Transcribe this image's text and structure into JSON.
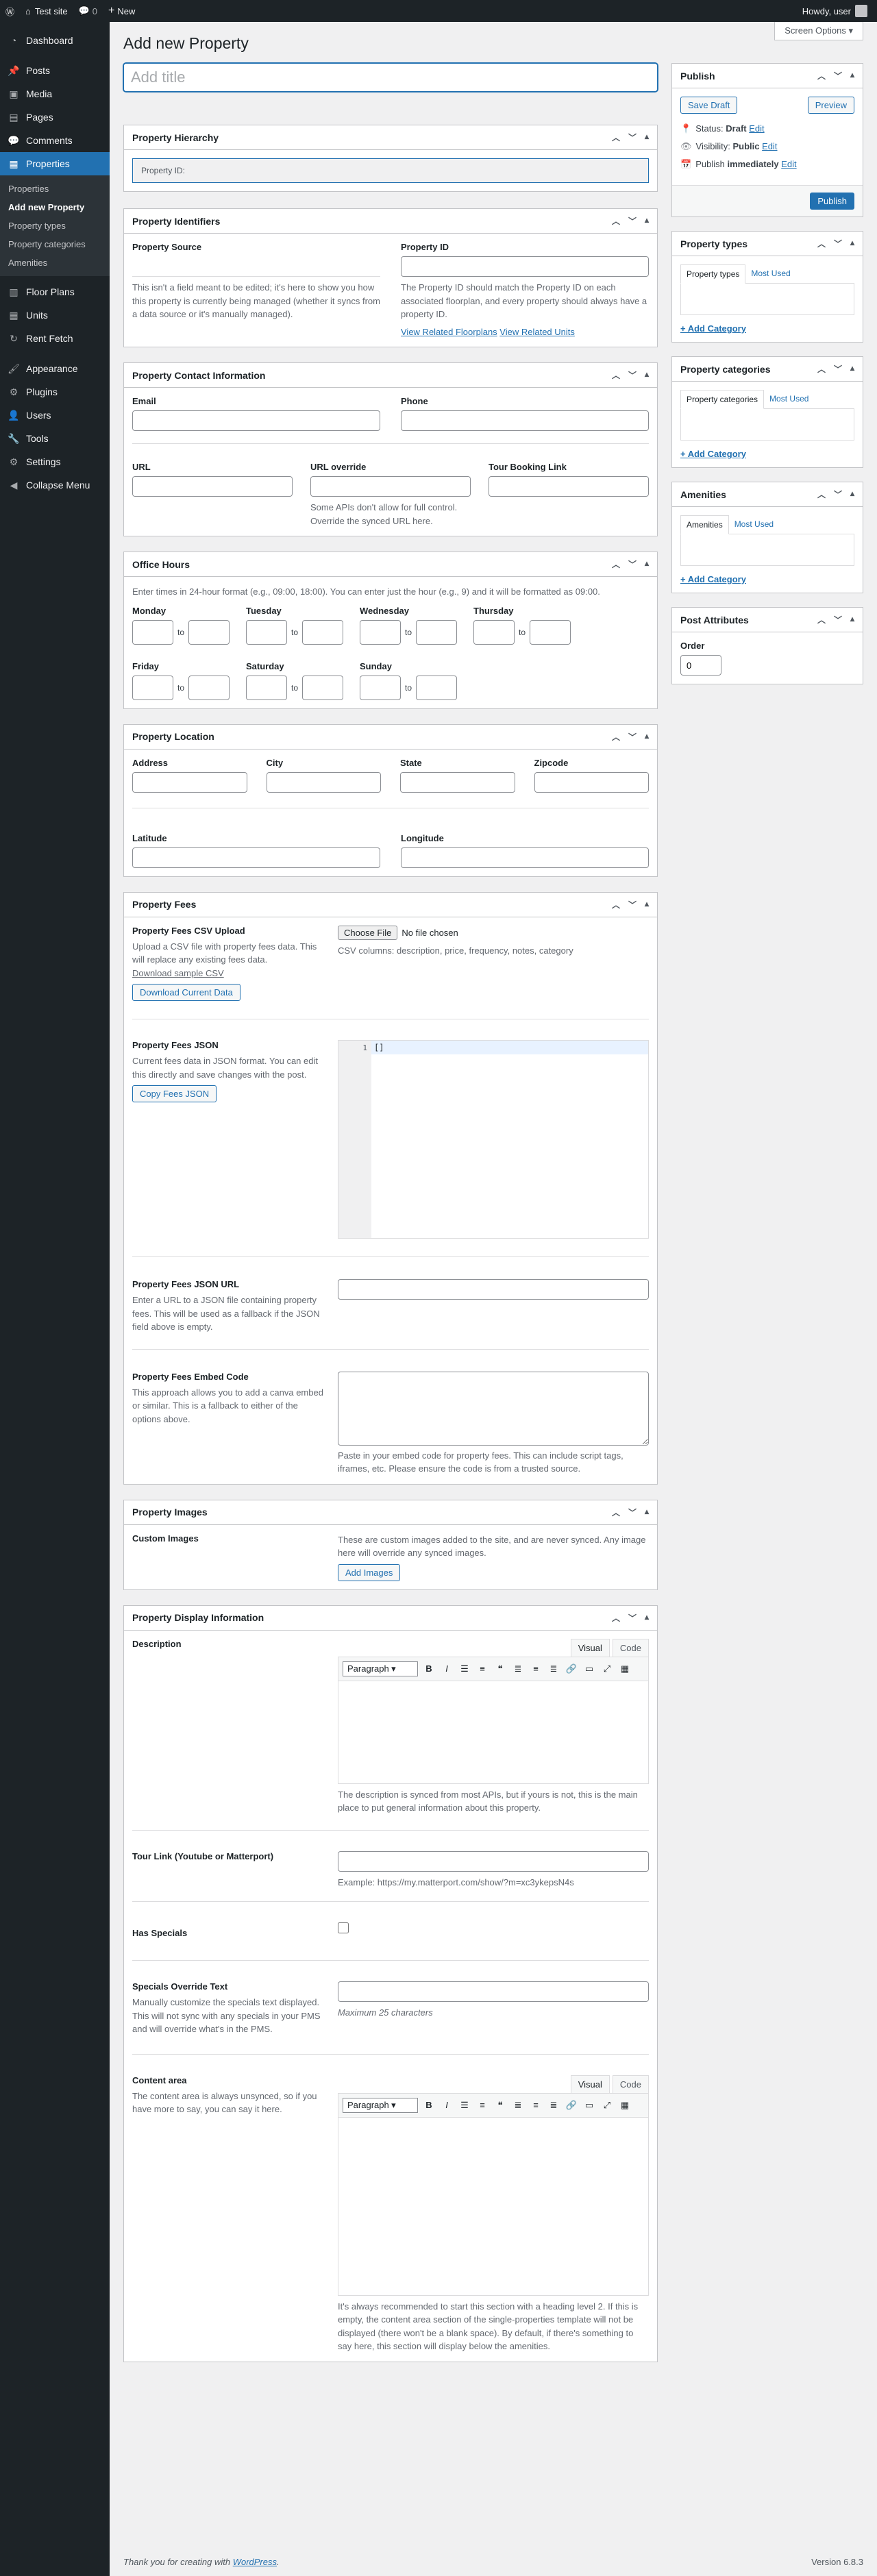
{
  "adminbar": {
    "wp_icon": "wordpress-icon",
    "site_name": "Test site",
    "comments_count": "0",
    "new_label": "New",
    "howdy": "Howdy, user"
  },
  "sidebar": {
    "items": [
      {
        "icon": "dashboard-icon",
        "label": "Dashboard"
      },
      {
        "icon": "pin-icon",
        "label": "Posts"
      },
      {
        "icon": "media-icon",
        "label": "Media"
      },
      {
        "icon": "page-icon",
        "label": "Pages"
      },
      {
        "icon": "comment-icon",
        "label": "Comments"
      },
      {
        "icon": "building-icon",
        "label": "Properties"
      }
    ],
    "submenu": [
      "Properties",
      "Add new Property",
      "Property types",
      "Property categories",
      "Amenities"
    ],
    "items2": [
      {
        "icon": "floorplan-icon",
        "label": "Floor Plans"
      },
      {
        "icon": "units-icon",
        "label": "Units"
      },
      {
        "icon": "refresh-icon",
        "label": "Rent Fetch"
      },
      {
        "icon": "appearance-icon",
        "label": "Appearance"
      },
      {
        "icon": "plugin-icon",
        "label": "Plugins"
      },
      {
        "icon": "users-icon",
        "label": "Users"
      },
      {
        "icon": "tools-icon",
        "label": "Tools"
      },
      {
        "icon": "settings-icon",
        "label": "Settings"
      },
      {
        "icon": "collapse-icon",
        "label": "Collapse Menu"
      }
    ]
  },
  "header": {
    "title": "Add new Property",
    "screen_options": "Screen Options",
    "title_placeholder": "Add title"
  },
  "hierarchy": {
    "title": "Property Hierarchy",
    "label": "Property ID:"
  },
  "identifiers": {
    "title": "Property Identifiers",
    "source_label": "Property Source",
    "source_desc": "This isn't a field meant to be edited; it's here to show you how this property is currently being managed (whether it syncs from a data source or it's manually managed).",
    "id_label": "Property ID",
    "id_desc": "The Property ID should match the Property ID on each associated floorplan, and every property should always have a property ID.",
    "link_floorplans": "View Related Floorplans",
    "link_units": "View Related Units"
  },
  "contact": {
    "title": "Property Contact Information",
    "email": "Email",
    "phone": "Phone",
    "url": "URL",
    "url_override": "URL override",
    "url_override_desc": "Some APIs don't allow for full control. Override the synced URL here.",
    "tour_link": "Tour Booking Link"
  },
  "hours": {
    "title": "Office Hours",
    "instructions": "Enter times in 24-hour format (e.g., 09:00, 18:00). You can enter just the hour (e.g., 9) and it will be formatted as 09:00.",
    "to": "to",
    "days": [
      "Monday",
      "Tuesday",
      "Wednesday",
      "Thursday",
      "Friday",
      "Saturday",
      "Sunday"
    ]
  },
  "location": {
    "title": "Property Location",
    "address": "Address",
    "city": "City",
    "state": "State",
    "zipcode": "Zipcode",
    "latitude": "Latitude",
    "longitude": "Longitude"
  },
  "fees": {
    "title": "Property Fees",
    "csv_label": "Property Fees CSV Upload",
    "csv_desc": "Upload a CSV file with property fees data. This will replace any existing fees data.",
    "csv_sample": "Download sample CSV",
    "csv_download": "Download Current Data",
    "choose_file": "Choose File",
    "no_file": "No file chosen",
    "csv_columns": "CSV columns: description, price, frequency, notes, category",
    "json_label": "Property Fees JSON",
    "json_desc": "Current fees data in JSON format. You can edit this directly and save changes with the post.",
    "json_copy": "Copy Fees JSON",
    "json_line_no": "1",
    "json_value": "[]",
    "json_url_label": "Property Fees JSON URL",
    "json_url_desc": "Enter a URL to a JSON file containing property fees. This will be used as a fallback if the JSON field above is empty.",
    "embed_label": "Property Fees Embed Code",
    "embed_desc": "This approach allows you to add a canva embed or similar. This is a fallback to either of the options above.",
    "embed_help": "Paste in your embed code for property fees. This can include script tags, iframes, etc. Please ensure the code is from a trusted source."
  },
  "images": {
    "title": "Property Images",
    "label": "Custom Images",
    "desc": "These are custom images added to the site, and are never synced. Any image here will override any synced images.",
    "button": "Add Images"
  },
  "display": {
    "title": "Property Display Information",
    "description_label": "Description",
    "visual_tab": "Visual",
    "code_tab": "Code",
    "paragraph": "Paragraph",
    "description_help": "The description is synced from most APIs, but if yours is not, this is the main place to put general information about this property.",
    "tour_label": "Tour Link (Youtube or Matterport)",
    "tour_help": "Example: https://my.matterport.com/show/?m=xc3ykepsN4s",
    "specials_label": "Has Specials",
    "specials_override_label": "Specials Override Text",
    "specials_override_desc": "Manually customize the specials text displayed. This will not sync with any specials in your PMS and will override what's in the PMS.",
    "specials_override_help": "Maximum 25 characters",
    "content_label": "Content area",
    "content_desc": "The content area is always unsynced, so if you have more to say, you can say it here.",
    "content_help": "It's always recommended to start this section with a heading level 2. If this is empty, the content area section of the single-properties template will not be displayed (there won't be a blank space). By default, if there's something to say here, this section will display below the amenities."
  },
  "publish": {
    "title": "Publish",
    "save_draft": "Save Draft",
    "preview": "Preview",
    "status_label": "Status:",
    "status_value": "Draft",
    "visibility_label": "Visibility:",
    "visibility_value": "Public",
    "publish_label": "Publish",
    "publish_value": "immediately",
    "edit": "Edit",
    "publish_button": "Publish"
  },
  "taxonomies": [
    {
      "title": "Property types",
      "tab_all": "Property types",
      "tab_used": "Most Used",
      "add": "+ Add Category"
    },
    {
      "title": "Property categories",
      "tab_all": "Property categories",
      "tab_used": "Most Used",
      "add": "+ Add Category"
    },
    {
      "title": "Amenities",
      "tab_all": "Amenities",
      "tab_used": "Most Used",
      "add": "+ Add Category"
    }
  ],
  "attributes": {
    "title": "Post Attributes",
    "order_label": "Order",
    "order_value": "0"
  },
  "footer": {
    "thanks_prefix": "Thank you for creating with ",
    "wordpress": "WordPress",
    "version": "Version 6.8.3"
  }
}
